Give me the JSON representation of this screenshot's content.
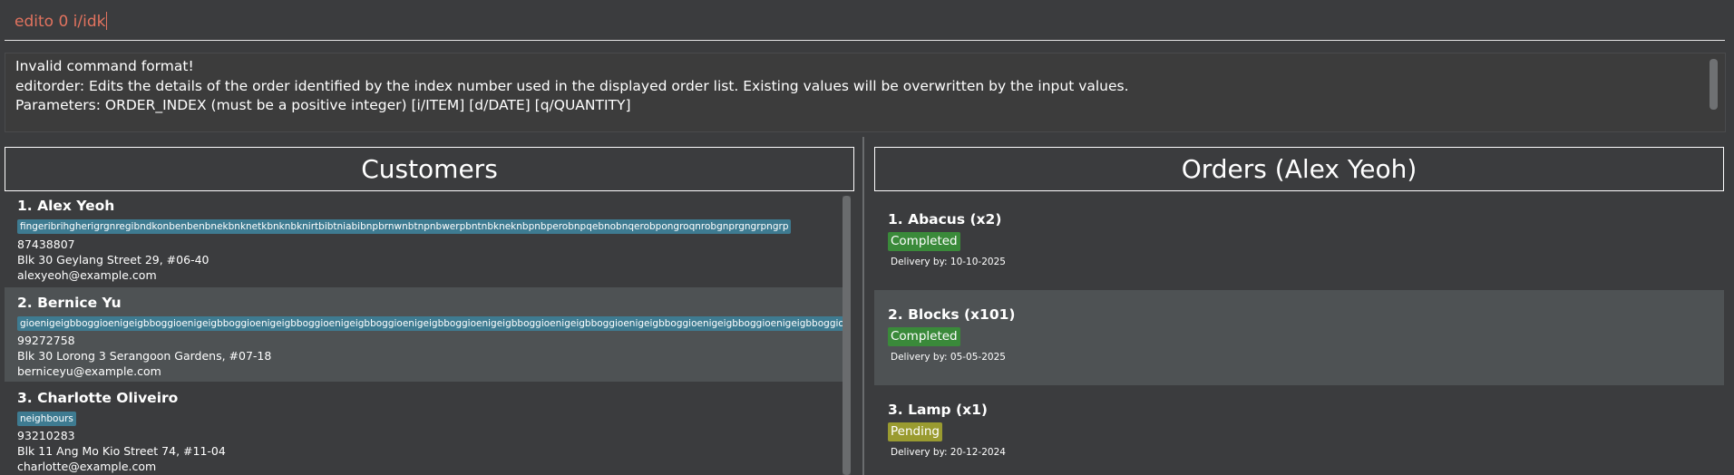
{
  "command": {
    "value": "edito 0 i/idk"
  },
  "result": {
    "lines": [
      "Invalid command format!",
      "editorder: Edits the details of the order identified by the index number used in the displayed order list. Existing values will be overwritten by the input values.",
      "Parameters: ORDER_INDEX (must be a positive integer) [i/ITEM] [d/DATE] [q/QUANTITY]"
    ]
  },
  "customers": {
    "title": "Customers",
    "items": [
      {
        "name": "1. Alex Yeoh",
        "tag": "fingeribrihgherigrgnregibndkonbenbenbnekbnknetkbnknbknirtbibtniabibnpbrnwnbtnpnbwerpbntnbkneknbpnbperobnpqebnobnqerobpongroqnrobgnprgngrpngrp",
        "phone": "87438807",
        "address": "Blk 30 Geylang Street 29, #06-40",
        "email": "alexyeoh@example.com"
      },
      {
        "name": "2. Bernice Yu",
        "tag": "gioenigeigbboggioenigeigbboggioenigeigbboggioenigeigbboggioenigeigbboggioenigeigbboggioenigeigbboggioenigeigbboggioenigeigbboggioenigeigbboggioenigeigbboggioenigeigbboggioenigeigbboggioen",
        "phone": "99272758",
        "address": "Blk 30 Lorong 3 Serangoon Gardens, #07-18",
        "email": "berniceyu@example.com"
      },
      {
        "name": "3. Charlotte Oliveiro",
        "tag": "neighbours",
        "phone": "93210283",
        "address": "Blk 11 Ang Mo Kio Street 74, #11-04",
        "email": "charlotte@example.com"
      }
    ]
  },
  "orders": {
    "title": "Orders (Alex Yeoh)",
    "items": [
      {
        "name": "1. Abacus (x2)",
        "status": "Completed",
        "status_color": "#3a8a3a",
        "delivery": "Delivery by: 10-10-2025"
      },
      {
        "name": "2. Blocks (x101)",
        "status": "Completed",
        "status_color": "#3a8a3a",
        "delivery": "Delivery by: 05-05-2025"
      },
      {
        "name": "3. Lamp (x1)",
        "status": "Pending",
        "status_color": "#9a9b30",
        "delivery": "Delivery by: 20-12-2024"
      }
    ]
  },
  "colors": {
    "background": "#3b3c3e",
    "command_text": "#e2735f",
    "tag": "#3e7b91",
    "selected_row": "#4e5254"
  }
}
